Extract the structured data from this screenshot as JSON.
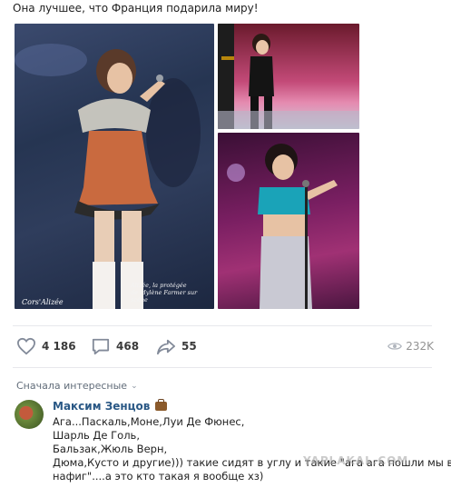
{
  "post": {
    "text": "Она лучшее, что Франция подарила миру!"
  },
  "photos": {
    "caption_lines": [
      "Alizée, la protégée",
      "de Mylène Farmer sur scène"
    ],
    "brand": "Cors'Alizée"
  },
  "actions": {
    "likes": "4 186",
    "comments": "468",
    "shares": "55",
    "views": "232K"
  },
  "comments_section": {
    "sort_label": "Сначала интересные",
    "comment": {
      "author": "Максим Зенцов",
      "lines": [
        "Ага...Паскаль,Моне,Луи Де Фюнес,",
        "Шарль Де Голь,",
        "Бальзак,Жюль Верн,",
        "Дюма,Кусто и другие))) такие сидят в углу и такие \"ага ага пошли мы все",
        "нафиг\"....а это кто такая я вообще хз)"
      ]
    }
  },
  "watermark": "YAPLAKAL.COM"
}
